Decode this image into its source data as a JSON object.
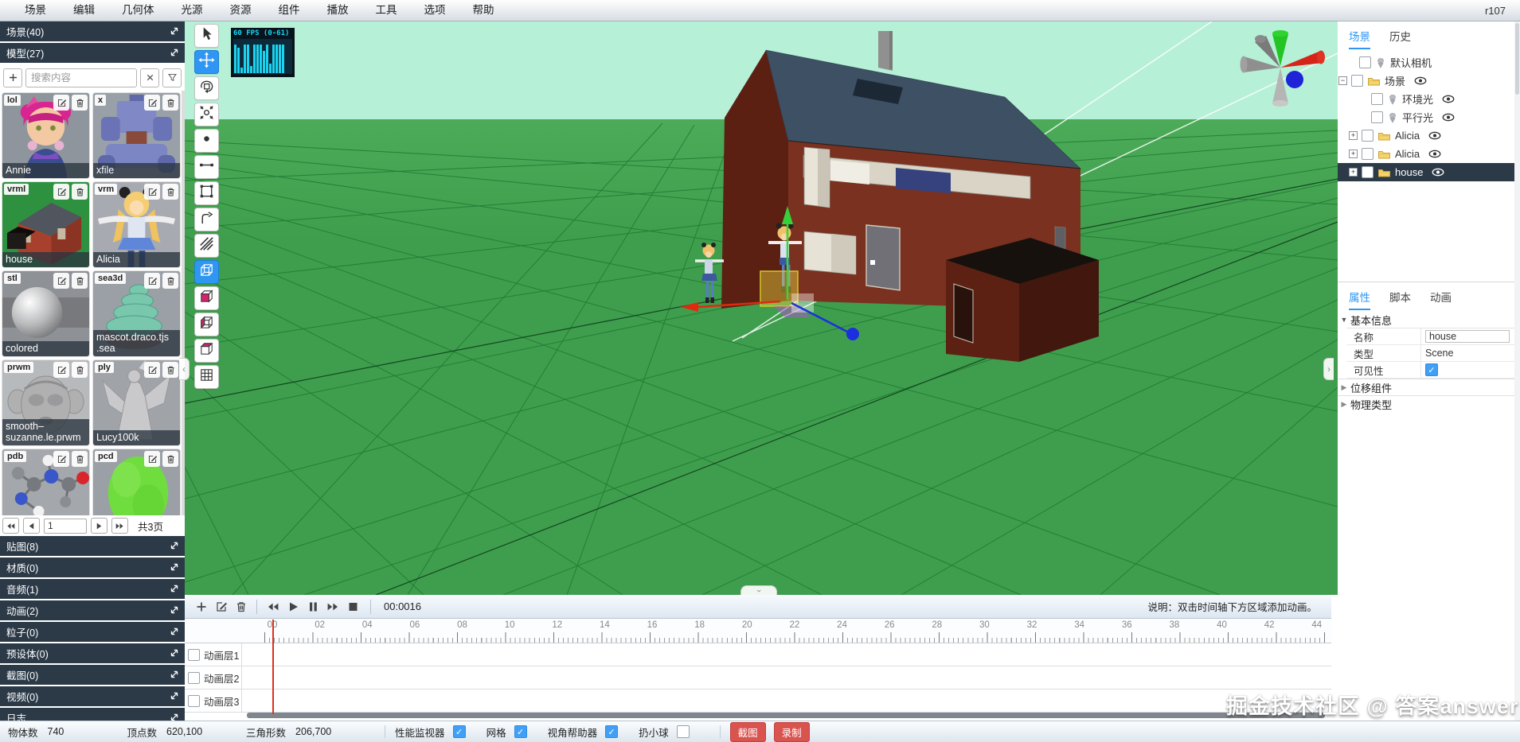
{
  "app": {
    "version": "r107"
  },
  "menu": {
    "items": [
      "场景",
      "编辑",
      "几何体",
      "光源",
      "资源",
      "组件",
      "播放",
      "工具",
      "选项",
      "帮助"
    ]
  },
  "left_sidebar": {
    "scene_panel": "场景(40)",
    "model_panel": "模型(27)",
    "search": {
      "placeholder": "搜索内容"
    },
    "models": [
      {
        "badge": "lol",
        "name": "Annie",
        "thumb": "annie"
      },
      {
        "badge": "x",
        "name": "xfile",
        "thumb": "xfile"
      },
      {
        "badge": "vrml",
        "name": "house",
        "thumb": "house"
      },
      {
        "badge": "vrm",
        "name": "Alicia",
        "thumb": "alicia"
      },
      {
        "badge": "stl",
        "name": "colored",
        "thumb": "sphere"
      },
      {
        "badge": "sea3d",
        "name": "mascot.draco.tjs.sea",
        "thumb": "turtle"
      },
      {
        "badge": "prwm",
        "name": "smooth-suzanne.le.prwm",
        "thumb": "suzanne"
      },
      {
        "badge": "ply",
        "name": "Lucy100k",
        "thumb": "lucy"
      },
      {
        "badge": "pdb",
        "name": "",
        "thumb": "molecule"
      },
      {
        "badge": "pcd",
        "name": "",
        "thumb": "pointcloud"
      }
    ],
    "pagination": {
      "page": "1",
      "total_label": "共3页"
    },
    "panels": [
      "贴图(8)",
      "材质(0)",
      "音频(1)",
      "动画(2)",
      "粒子(0)",
      "预设体(0)",
      "截图(0)",
      "视频(0)",
      "日志"
    ]
  },
  "toolbar": {
    "tools": [
      {
        "icon": "select",
        "active": false
      },
      {
        "icon": "move",
        "active": true
      },
      {
        "icon": "rotate",
        "active": false
      },
      {
        "icon": "focus",
        "active": false
      },
      {
        "icon": "point",
        "active": false
      },
      {
        "icon": "segment",
        "active": false
      },
      {
        "icon": "rectangle",
        "active": false
      },
      {
        "icon": "curve",
        "active": false
      },
      {
        "icon": "hatch",
        "active": false
      },
      {
        "icon": "cube-wire",
        "active": true
      },
      {
        "icon": "cube-solid",
        "active": false
      },
      {
        "icon": "cube-left",
        "active": false
      },
      {
        "icon": "cube-top",
        "active": false
      },
      {
        "icon": "grid",
        "active": false
      }
    ]
  },
  "viewport": {
    "fps_label": "60 FPS (0-61)",
    "fps_bars": [
      36,
      32,
      7,
      36,
      36,
      9,
      36,
      36,
      36,
      28,
      36,
      12,
      36,
      36,
      36,
      36
    ]
  },
  "right_panel": {
    "tabs": [
      {
        "label": "场景",
        "active": true
      },
      {
        "label": "历史",
        "active": false
      }
    ],
    "tree": [
      {
        "label": "默认相机",
        "icon": "object",
        "level": 1,
        "expander": "",
        "eye": false,
        "selected": false
      },
      {
        "label": "场景",
        "icon": "folder",
        "level": 0,
        "expander": "minus",
        "eye": true,
        "selected": false
      },
      {
        "label": "环境光",
        "icon": "object",
        "level": 2,
        "expander": "",
        "eye": true,
        "selected": false
      },
      {
        "label": "平行光",
        "icon": "object",
        "level": 2,
        "expander": "",
        "eye": true,
        "selected": false
      },
      {
        "label": "Alicia",
        "icon": "folder",
        "level": 1,
        "expander": "plus",
        "eye": true,
        "selected": false
      },
      {
        "label": "Alicia",
        "icon": "folder",
        "level": 1,
        "expander": "plus",
        "eye": true,
        "selected": false
      },
      {
        "label": "house",
        "icon": "folder",
        "level": 1,
        "expander": "plus",
        "eye": true,
        "selected": true
      }
    ],
    "prop_tabs": [
      {
        "label": "属性",
        "active": true
      },
      {
        "label": "脚本",
        "active": false
      },
      {
        "label": "动画",
        "active": false
      }
    ],
    "basic_section": "基本信息",
    "props": [
      {
        "label": "名称",
        "value": "house",
        "type": "input"
      },
      {
        "label": "类型",
        "value": "Scene",
        "type": "text"
      },
      {
        "label": "可见性",
        "value": "",
        "type": "checkbox"
      }
    ],
    "collapsed_sections": [
      "位移组件",
      "物理类型"
    ]
  },
  "timeline": {
    "time": "00:0016",
    "hint": "说明：双击时间轴下方区域添加动画。",
    "ticks": [
      "00",
      "02",
      "04",
      "06",
      "08",
      "10",
      "12",
      "14",
      "16",
      "18",
      "20",
      "22",
      "24",
      "26",
      "28",
      "30",
      "32",
      "34",
      "36",
      "38",
      "40",
      "42",
      "44"
    ],
    "layers": [
      "动画层1",
      "动画层2",
      "动画层3"
    ]
  },
  "status_bar": {
    "counters": [
      {
        "label": "物体数",
        "value": "740"
      },
      {
        "label": "顶点数",
        "value": "620,100"
      },
      {
        "label": "三角形数",
        "value": "206,700"
      }
    ],
    "toggles": [
      {
        "label": "性能监视器",
        "checked": true
      },
      {
        "label": "网格",
        "checked": true
      },
      {
        "label": "视角帮助器",
        "checked": true
      },
      {
        "label": "扔小球",
        "checked": false
      }
    ],
    "buttons": [
      "截图",
      "录制"
    ]
  },
  "watermark": "掘金技术社区 @ 答案answer",
  "colors": {
    "accent": "#2f96f3",
    "panel_dark": "#2c3a48",
    "danger": "#d9534f",
    "fps_cyan": "#19d3f0",
    "sky": "#b6f0d7",
    "ground": "#3f9e4d"
  }
}
